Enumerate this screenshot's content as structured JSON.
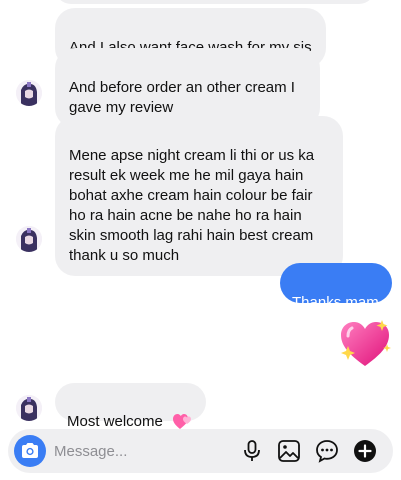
{
  "messages": [
    {
      "text": "And I also want face wash for my sis"
    },
    {
      "text": "And before order an other cream I\ngave my review"
    },
    {
      "text": "Mene apse night cream li thi  or us ka\nresult ek week me he mil gaya hain\nbohat axhe cream hain colour be fair\nho ra hain acne be nahe ho ra hain\nskin smooth lag rahi hain best cream\nthank u so much"
    },
    {
      "text": "Thanks mam"
    },
    {
      "text": "Most welcome"
    }
  ],
  "composer": {
    "placeholder": "Message..."
  },
  "colors": {
    "outgoing_bubble": "#3a7df4",
    "incoming_bubble": "#efeff1",
    "camera_button": "#3a7df4"
  },
  "icons": [
    "camera-icon",
    "microphone-icon",
    "gallery-icon",
    "sticker-icon",
    "plus-icon",
    "sparkling-heart-icon",
    "two-hearts-icon"
  ]
}
